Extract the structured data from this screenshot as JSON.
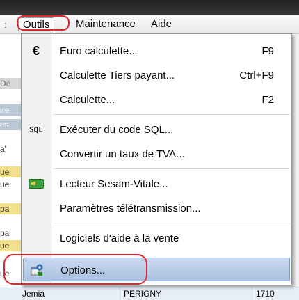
{
  "menubar": {
    "left_fragment": ":",
    "menus": [
      "Outils",
      "Maintenance",
      "Aide"
    ]
  },
  "background": {
    "fragments": [
      "Dé",
      "ire",
      "es",
      "a'",
      "ue",
      "ue",
      "pa",
      "pa",
      "ue",
      "ue"
    ],
    "bottom_row": {
      "cell1": "Jemia",
      "cell2": "PERIGNY",
      "cell3": "1710"
    }
  },
  "dropdown": {
    "items": [
      {
        "icon": "euro-icon",
        "label": "Euro calculette...",
        "shortcut": "F9"
      },
      {
        "icon": "",
        "label": "Calculette Tiers payant...",
        "shortcut": "Ctrl+F9"
      },
      {
        "icon": "",
        "label": "Calculette...",
        "shortcut": "F2"
      },
      {
        "icon": "sql-icon",
        "label": "Exécuter du code SQL...",
        "shortcut": ""
      },
      {
        "icon": "",
        "label": "Convertir un taux de TVA...",
        "shortcut": ""
      },
      {
        "icon": "card-reader-icon",
        "label": "Lecteur Sesam-Vitale...",
        "shortcut": ""
      },
      {
        "icon": "",
        "label": "Paramètres télétransmission...",
        "shortcut": ""
      },
      {
        "icon": "",
        "label": "Logiciels d'aide à la vente",
        "shortcut": ""
      },
      {
        "icon": "options-gear-icon",
        "label": "Options...",
        "shortcut": ""
      }
    ],
    "euro_glyph": "€",
    "sql_glyph": "SQL"
  },
  "colors": {
    "highlight_ring": "#e0262e",
    "selected_item": "#a9c2e2"
  }
}
